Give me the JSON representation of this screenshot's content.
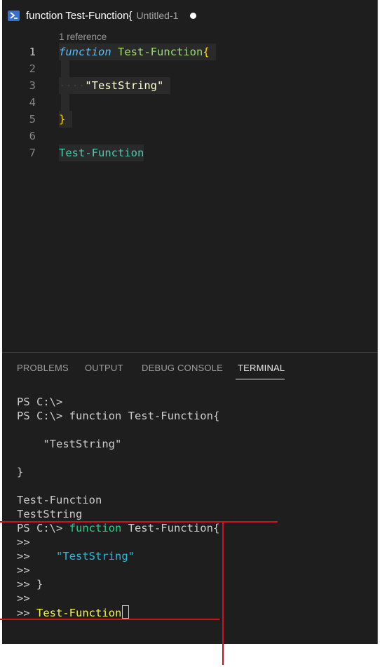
{
  "tab": {
    "title": "function Test-Function{",
    "description": "Untitled-1",
    "icon": "powershell-icon"
  },
  "editor": {
    "codelens": "1 reference",
    "line_numbers": [
      "1",
      "2",
      "3",
      "4",
      "5",
      "6",
      "7"
    ],
    "lines": {
      "l1_keyword": "function",
      "l1_name": "Test-Function",
      "l1_brace": "{",
      "l3_indent": "····",
      "l3_string": "\"TestString\"",
      "l5_brace": "}",
      "l7_call": "Test-Function"
    }
  },
  "panel": {
    "tabs": [
      "PROBLEMS",
      "OUTPUT",
      "DEBUG CONSOLE",
      "TERMINAL"
    ],
    "active_tab": "TERMINAL"
  },
  "terminal": {
    "lines": [
      "PS C:\\>",
      "PS C:\\> function Test-Function{",
      "    \"TestString\"",
      "}",
      "Test-Function",
      "TestString"
    ],
    "prompt": "PS C:\\> ",
    "echo_keyword": "function",
    "echo_rest": " Test-Function{",
    "continuation": ">>",
    "echo_string": "\"TestString\"",
    "echo_close": ">> }",
    "echo_call": "Test-Function"
  },
  "colors": {
    "annotation": "#d0101a",
    "editor_bg": "#1e1e1e",
    "active_tab_underline": "#e7e7e7"
  }
}
